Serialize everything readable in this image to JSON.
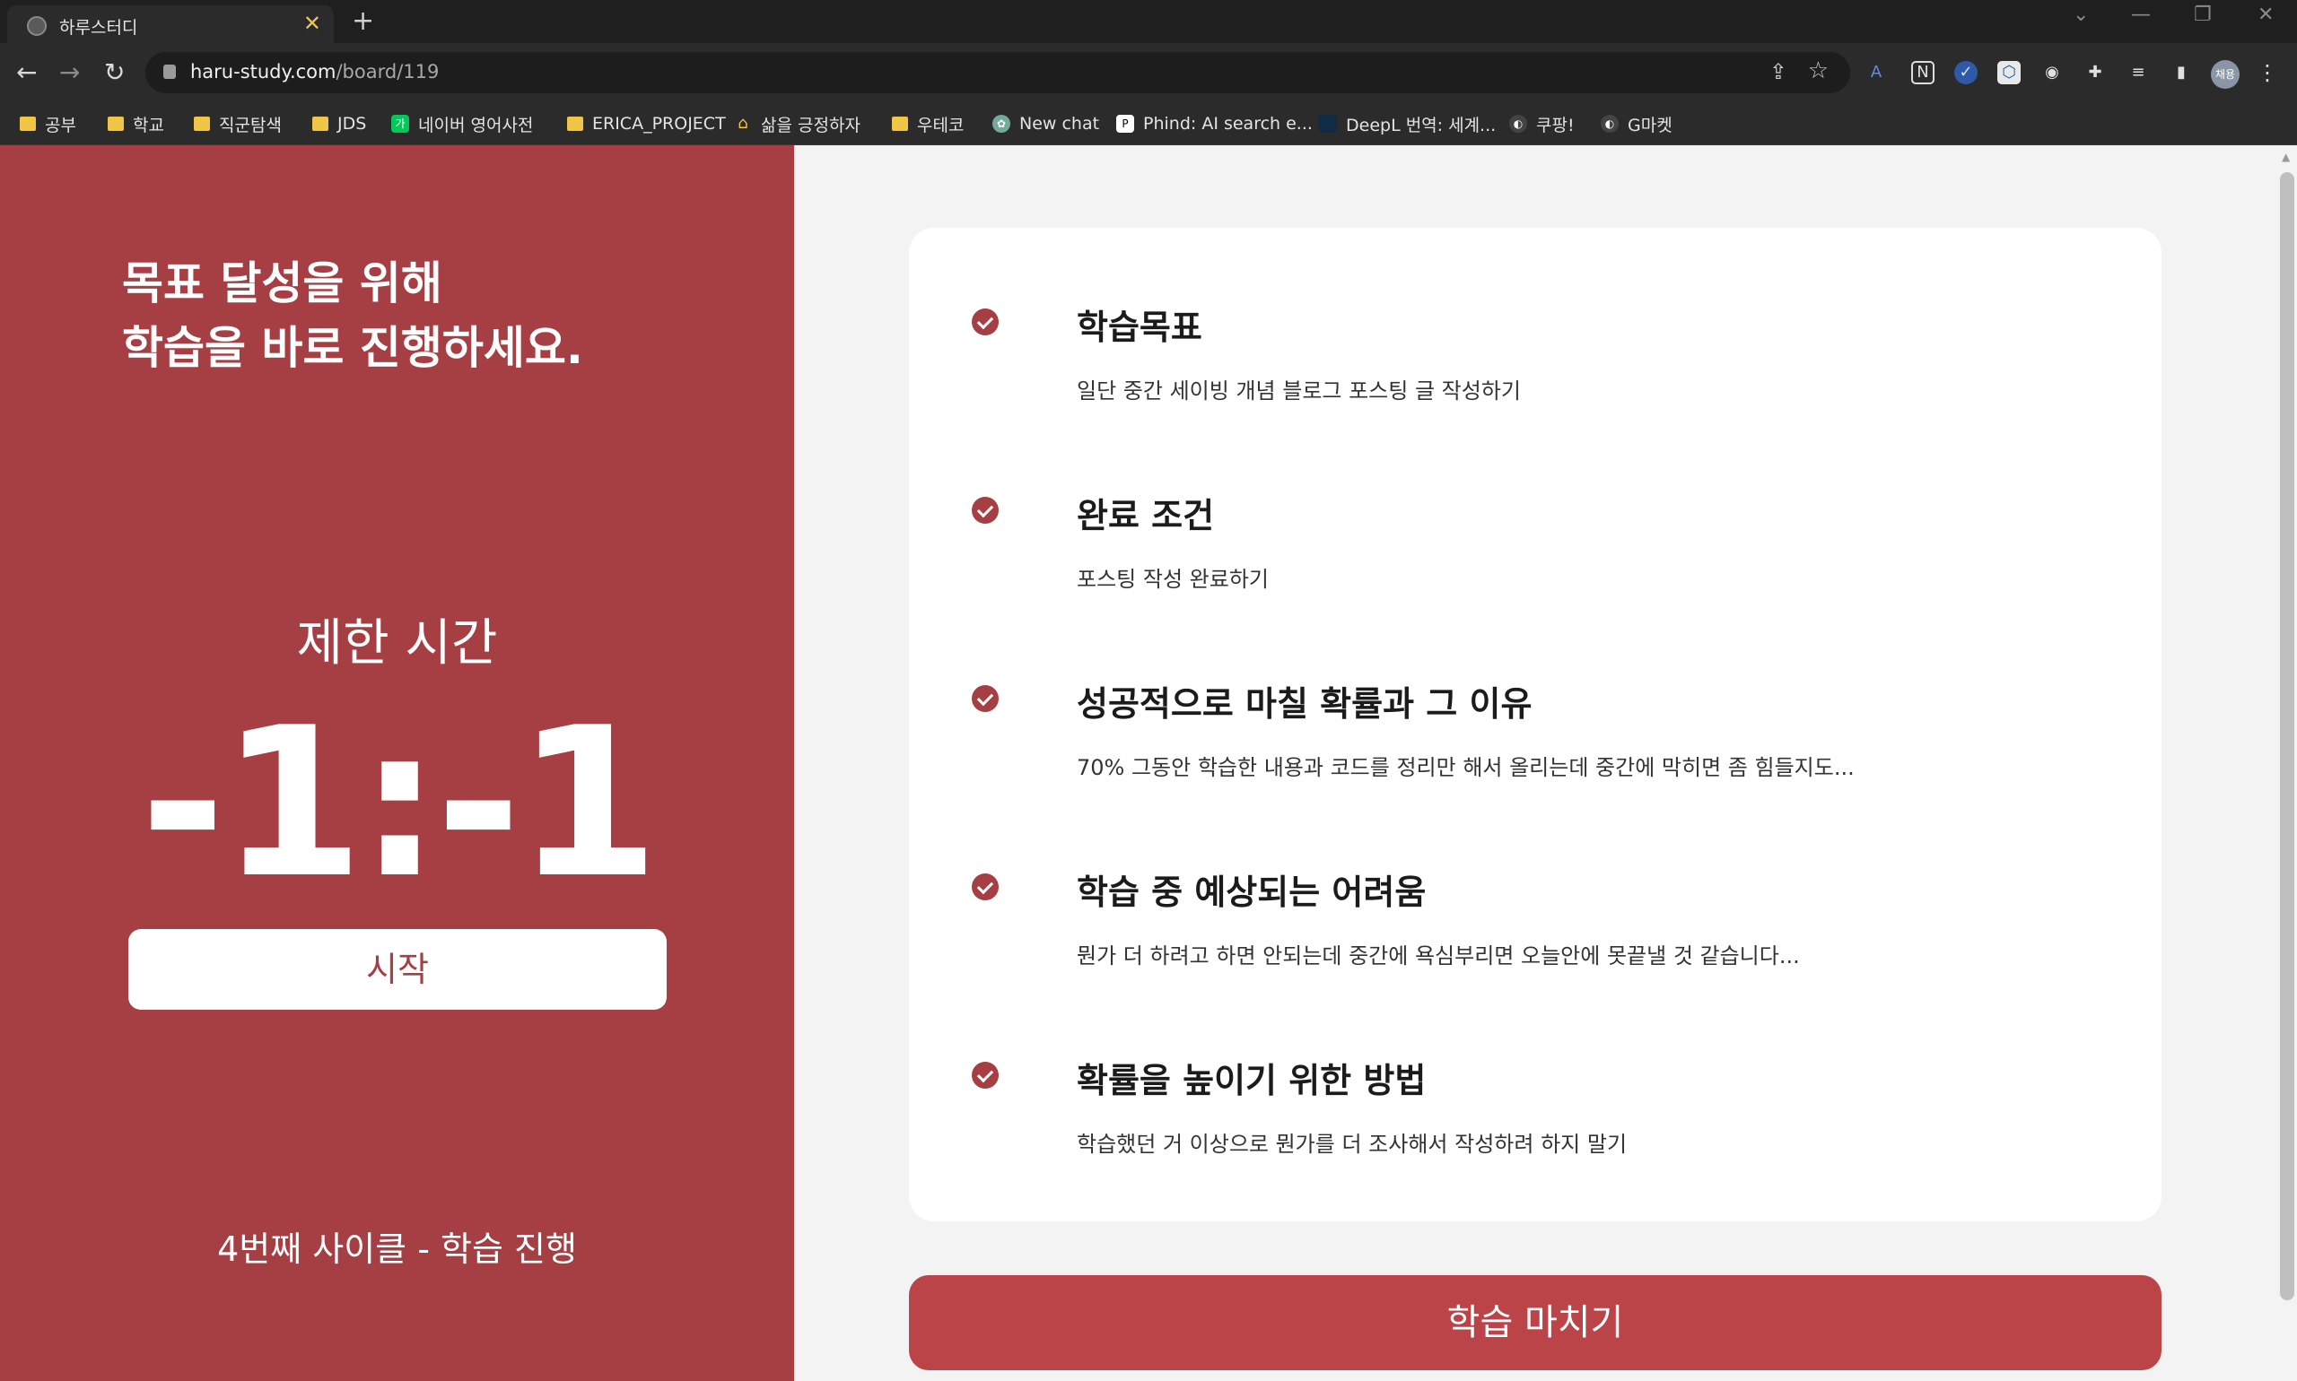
{
  "browser": {
    "tab_title": "하루스터디",
    "tab_close": "✕",
    "new_tab": "+",
    "url_domain": "haru-study.com",
    "url_path": "/board/119",
    "avatar_text": "채용",
    "window_controls": [
      "⌄",
      "—",
      "❐",
      "✕"
    ],
    "bookmarks": [
      {
        "label": "공부",
        "icon": "folder-icon"
      },
      {
        "label": "학교",
        "icon": "folder-icon"
      },
      {
        "label": "직군탐색",
        "icon": "folder-icon"
      },
      {
        "label": "JDS",
        "icon": "folder-icon"
      },
      {
        "label": "네이버 영어사전",
        "icon": "naver-dict-icon"
      },
      {
        "label": "ERICA_PROJECT",
        "icon": "folder-icon"
      },
      {
        "label": "삶을 긍정하자",
        "icon": "house-icon"
      },
      {
        "label": "우테코",
        "icon": "folder-icon"
      },
      {
        "label": "New chat",
        "icon": "openai-icon"
      },
      {
        "label": "Phind: AI search e...",
        "icon": "phind-icon"
      },
      {
        "label": "DeepL 번역: 세계...",
        "icon": "deepl-icon"
      },
      {
        "label": "쿠팡!",
        "icon": "globe-icon"
      },
      {
        "label": "G마켓",
        "icon": "globe-icon"
      }
    ]
  },
  "left": {
    "headline_line1": "목표 달성을 위해",
    "headline_line2": "학습을 바로 진행하세요.",
    "timer_label": "제한 시간",
    "timer_value": "-1:-1",
    "start_button": "시작",
    "cycle_text": "4번째 사이클 - 학습 진행"
  },
  "items": [
    {
      "title": "학습목표",
      "desc": "일단 중간 세이빙 개념 블로그 포스팅 글 작성하기"
    },
    {
      "title": "완료 조건",
      "desc": "포스팅 작성 완료하기"
    },
    {
      "title": "성공적으로 마칠 확률과 그 이유",
      "desc": "70% 그동안 학습한 내용과 코드를 정리만 해서 올리는데 중간에 막히면 좀 힘들지도..."
    },
    {
      "title": "학습 중 예상되는 어려움",
      "desc": "뭔가 더 하려고 하면 안되는데 중간에 욕심부리면 오늘안에 못끝낼 것 같습니다..."
    },
    {
      "title": "확률을 높이기 위한 방법",
      "desc": "학습했던 거 이상으로 뭔가를 더 조사해서 작성하려 하지 말기"
    }
  ],
  "finish_button": "학습 마치기",
  "colors": {
    "brand": "#a63f43",
    "finish": "#bb4448",
    "page_bg": "#f3f3f3"
  }
}
